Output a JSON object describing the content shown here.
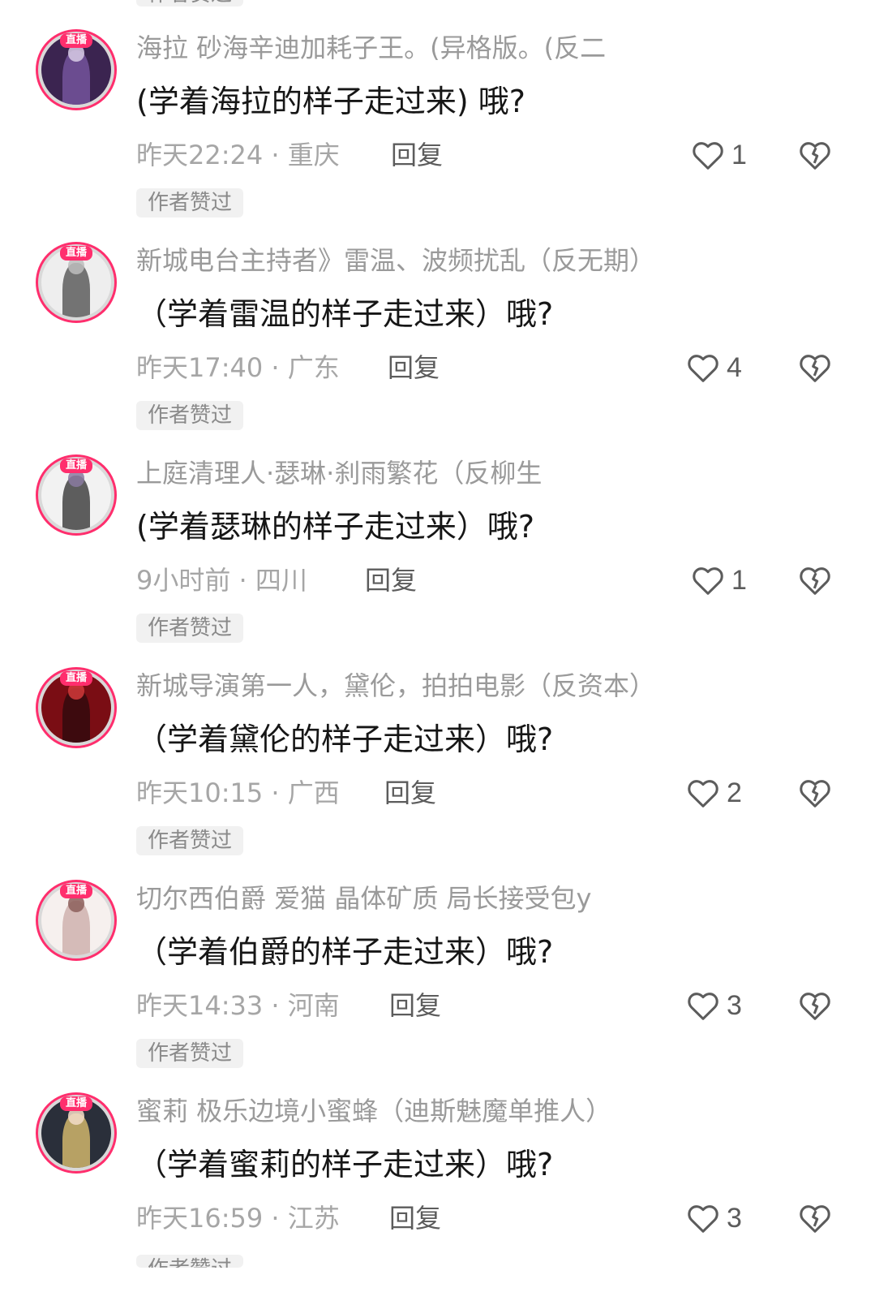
{
  "comments": [
    {
      "live_tag": "直播",
      "nickname": "海拉 砂海辛迪加耗子王。(异格版。(反二",
      "text": "(学着海拉的样子走过来) 哦?",
      "time_location": "昨天22:24 · 重庆",
      "reply_label": "回复",
      "like_count": "1",
      "author_badge": "作者赞过",
      "avatar_colors": [
        "#3b2450",
        "#7c5aa6",
        "#d8cde6"
      ]
    },
    {
      "live_tag": "直播",
      "nickname": "新城电台主持者》雷温、波频扰乱（反无期）",
      "text": "（学着雷温的样子走过来）哦?",
      "time_location": "昨天17:40 · 广东",
      "reply_label": "回复",
      "like_count": "4",
      "author_badge": "作者赞过",
      "avatar_colors": [
        "#eeeeee",
        "#4a4a4a",
        "#bdbdbd"
      ]
    },
    {
      "live_tag": "直播",
      "nickname": "上庭清理人·瑟琳·刹雨繁花（反柳生",
      "text": "(学着瑟琳的样子走过来）哦?",
      "time_location": "9小时前 · 四川",
      "reply_label": "回复",
      "like_count": "1",
      "author_badge": "作者赞过",
      "avatar_colors": [
        "#f2f2f2",
        "#2b2b2b",
        "#8a7aa0"
      ]
    },
    {
      "live_tag": "直播",
      "nickname": "新城导演第一人，黛伦，拍拍电影（反资本）",
      "text": "（学着黛伦的样子走过来）哦?",
      "time_location": "昨天10:15 · 广西",
      "reply_label": "回复",
      "like_count": "2",
      "author_badge": "作者赞过",
      "avatar_colors": [
        "#7a0d14",
        "#2a0a0c",
        "#d23a3a"
      ]
    },
    {
      "live_tag": "直播",
      "nickname": "切尔西伯爵 爱猫 晶体矿质 局长接受包y",
      "text": "（学着伯爵的样子走过来）哦?",
      "time_location": "昨天14:33 · 河南",
      "reply_label": "回复",
      "like_count": "3",
      "author_badge": "作者赞过",
      "avatar_colors": [
        "#f6f0ee",
        "#c9a9a6",
        "#8c5f5a"
      ]
    },
    {
      "live_tag": "直播",
      "nickname": "蜜莉 极乐边境小蜜蜂（迪斯魅魔单推人）",
      "text": "（学着蜜莉的样子走过来）哦?",
      "time_location": "昨天16:59 · 江苏",
      "reply_label": "回复",
      "like_count": "3",
      "author_badge": "作者赞过",
      "avatar_colors": [
        "#2a2f3a",
        "#e7c873",
        "#f3dcc8"
      ]
    }
  ],
  "top_partial_badge": "作者赞过"
}
